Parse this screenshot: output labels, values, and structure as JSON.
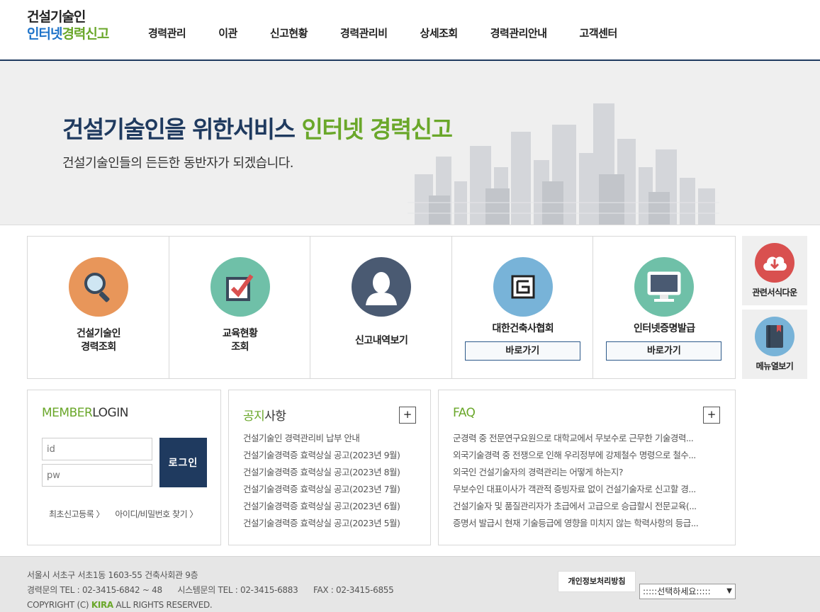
{
  "header": {
    "logo_line1": "건설기술인",
    "logo_line2a": "인터넷",
    "logo_line2b": "경력신고",
    "nav": [
      "경력관리",
      "이관",
      "신고현황",
      "경력관리비",
      "상세조회",
      "경력관리안내",
      "고객센터"
    ]
  },
  "hero": {
    "title_main": "건설기술인을 위한서비스 ",
    "title_accent": "인터넷 경력신고",
    "subtitle": "건설기술인들의 든든한 동반자가 되겠습니다."
  },
  "quick": {
    "items": [
      {
        "line1": "건설기술인",
        "line2": "경력조회",
        "icon": "search-icon"
      },
      {
        "line1": "교육현황",
        "line2": "조회",
        "icon": "checkbox-icon"
      },
      {
        "line1": "신고내역보기",
        "icon": "user-icon"
      },
      {
        "line1": "대한건축사협회",
        "button": "바로가기",
        "icon": "kira-logo-icon"
      },
      {
        "line1": "인터넷증명발급",
        "button": "바로가기",
        "icon": "monitor-icon"
      }
    ]
  },
  "side": {
    "download_label": "관련서식다운",
    "menu_label": "메뉴열보기"
  },
  "login": {
    "title_accent": "MEMBER",
    "title_rest": "LOGIN",
    "id_placeholder": "id",
    "pw_placeholder": "pw",
    "button": "로그인",
    "signup_link": "최초신고등록 〉",
    "find_link": "아이디/비밀번호 찾기 〉"
  },
  "notice": {
    "title_accent": "공지",
    "title_rest": "사항",
    "more": "+",
    "items": [
      "건설기술인 경력관리비 납부 안내",
      "건설기술경력증 효력상실 공고(2023년 9월)",
      "건설기술경력증 효력상실 공고(2023년 8월)",
      "건설기술경력증 효력상실 공고(2023년 7월)",
      "건설기술경력증 효력상실 공고(2023년 6월)",
      "건설기술경력증 효력상실 공고(2023년 5월)"
    ]
  },
  "faq": {
    "title": "FAQ",
    "more": "+",
    "items": [
      "군경력 중 전문연구요원으로 대학교에서 무보수로 근무한 기술경력...",
      "외국기술경력 중 전쟁으로 인해 우리정부에 강제철수 명령으로 철수...",
      "외국인 건설기술자의 경력관리는 어떻게 하는지?",
      "무보수인 대표이사가 객관적 증빙자료 없이 건설기술자로 신고할 경...",
      "건설기술자 및 품질관리자가 초급에서 고급으로 승급할시 전문교육(...",
      "증명서 발급시 현재 기술등급에 영향을 미치지 않는 학력사항의 등급..."
    ]
  },
  "footer": {
    "address": "서울시 서초구 서초1동 1603-55 건축사회관 9층",
    "tel_career": "경력문의 TEL : 02-3415-6842 ~ 48",
    "tel_system": "시스템문의 TEL : 02-3415-6883",
    "fax": "FAX : 02-3415-6855",
    "copyright_pre": "COPYRIGHT (C) ",
    "copyright_brand": "KIRA",
    "copyright_post": " ALL RIGHTS RESERVED.",
    "privacy_button": "개인정보처리방침",
    "select_value": ":::::선택하세요:::::"
  },
  "colors": {
    "navy": "#1f3a5f",
    "green": "#6aa72a",
    "orange": "#e8965a",
    "teal": "#6fc0a8",
    "slate": "#4a5a72",
    "sky": "#78b3d8",
    "red": "#d9504f"
  }
}
